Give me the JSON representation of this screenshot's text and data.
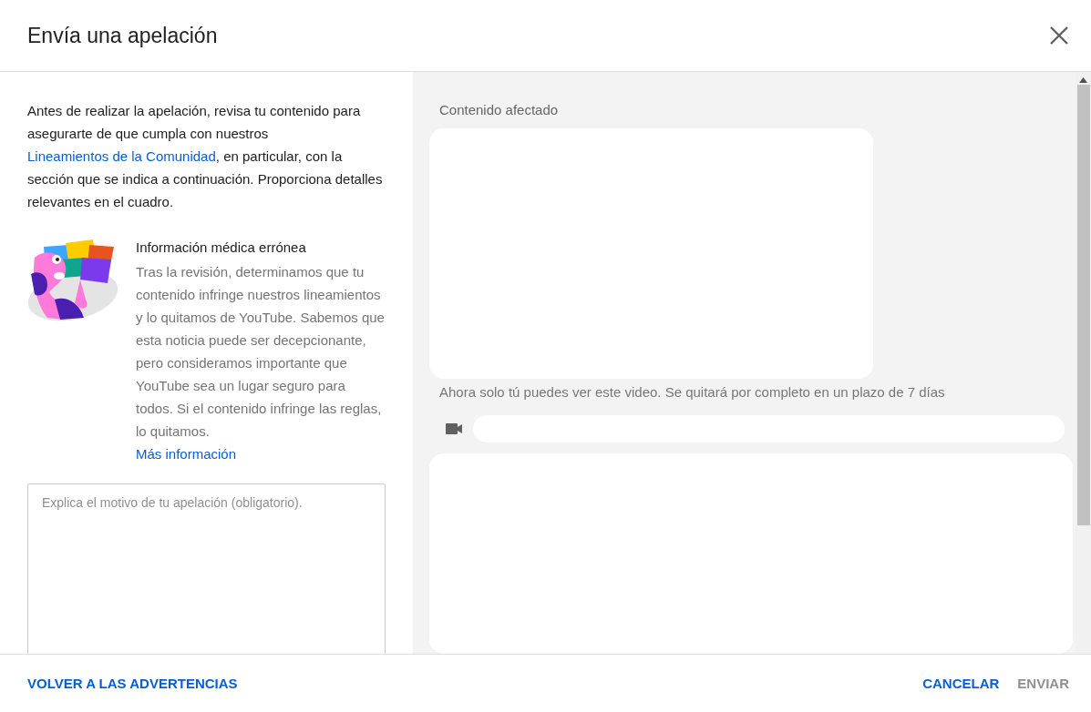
{
  "dialog": {
    "title": "Envía una apelación"
  },
  "intro": {
    "before": "Antes de realizar la apelación, revisa tu contenido para asegurarte de que cumpla con nuestros ",
    "link": "Lineamientos de la Comunidad",
    "after": ", en particular, con la sección que se indica a continuación. Proporciona detalles relevantes en el cuadro."
  },
  "violation": {
    "title": "Información médica errónea",
    "text": "Tras la revisión, determinamos que tu contenido infringe nuestros lineamientos y lo quitamos de YouTube. Sabemos que esta noticia puede ser decepcionante, pero consideramos importante que YouTube sea un lugar seguro para todos. Si el contenido infringe las reglas, lo quitamos.",
    "link": "Más información"
  },
  "appeal_field": {
    "placeholder": "Explica el motivo de tu apelación (obligatorio)."
  },
  "affected": {
    "label": "Contenido afectado",
    "note": "Ahora solo tú puedes ver este video. Se quitará por completo en un plazo de 7 días"
  },
  "footer": {
    "back": "VOLVER A LAS ADVERTENCIAS",
    "buttons": [
      {
        "label": "CANCELAR",
        "disabled": false
      },
      {
        "label": "ENVIAR",
        "disabled": true
      }
    ]
  }
}
